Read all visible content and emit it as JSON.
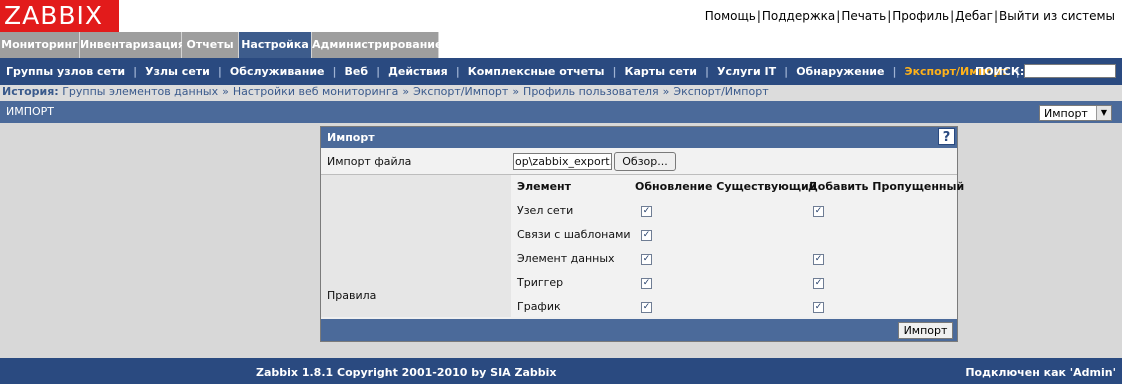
{
  "logo": "ZABBIX",
  "toplinks": [
    "Помощь",
    "Поддержка",
    "Печать",
    "Профиль",
    "Дебаг",
    "Выйти из системы"
  ],
  "main_menu": [
    "Мониторинг",
    "Инвентаризация",
    "Отчеты",
    "Настройка",
    "Администрирование"
  ],
  "active_main": "Настройка",
  "sub_menu": [
    "Группы узлов сети",
    "Узлы сети",
    "Обслуживание",
    "Веб",
    "Действия",
    "Комплексные отчеты",
    "Карты сети",
    "Услуги IT",
    "Обнаружение",
    "Экспорт/Импорт"
  ],
  "active_sub": "Экспорт/Импорт",
  "search_label": "ПОИСК:",
  "search_value": "",
  "history": {
    "label": "История:",
    "items": [
      "Группы элементов данных",
      "Настройки веб мониторинга",
      "Экспорт/Импорт",
      "Профиль пользователя",
      "Экспорт/Импорт"
    ]
  },
  "page_title": "ИМПОРТ",
  "page_select": "Импорт",
  "form": {
    "title": "Импорт",
    "help": "?",
    "file_label": "Импорт файла",
    "file_value": "op\\zabbix_export.xml",
    "browse": "Обзор...",
    "rules_label": "Правила",
    "col_element": "Элемент",
    "col_update": "Обновление Существующий",
    "col_add": "Добавить Пропущенный",
    "rules": [
      {
        "name": "Узел сети",
        "update": true,
        "add": true
      },
      {
        "name": "Связи с шаблонами",
        "update": true,
        "add": false
      },
      {
        "name": "Элемент данных",
        "update": true,
        "add": true
      },
      {
        "name": "Триггер",
        "update": true,
        "add": true
      },
      {
        "name": "График",
        "update": true,
        "add": true
      }
    ],
    "submit": "Импорт"
  },
  "footer": {
    "copyright": "Zabbix 1.8.1 Copyright 2001-2010 by SIA Zabbix",
    "connected": "Подключен как 'Admin'"
  }
}
